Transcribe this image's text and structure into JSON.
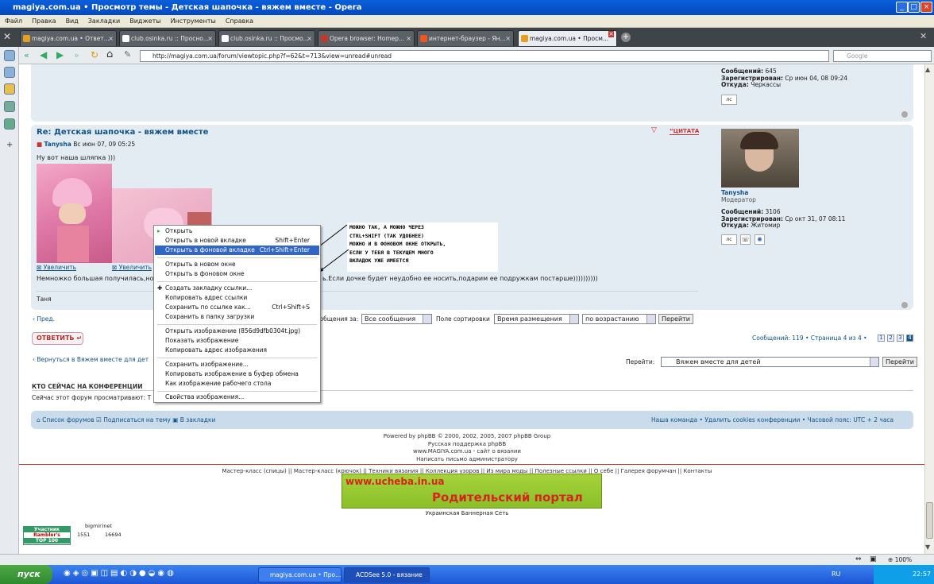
{
  "window": {
    "title": "magiya.com.ua • Просмотр темы - Детская шапочка - вяжем вместе - Opera"
  },
  "menu": [
    "Файл",
    "Правка",
    "Вид",
    "Закладки",
    "Виджеты",
    "Инструменты",
    "Справка"
  ],
  "tabs": [
    {
      "label": "magiya.com.ua • Ответ..."
    },
    {
      "label": "club.osinka.ru :: Просно..."
    },
    {
      "label": "club.osinka.ru :: Просмо..."
    },
    {
      "label": "Opera browser: Homep..."
    },
    {
      "label": "интернет-браузер - Ян..."
    },
    {
      "label": "magiya.com.ua • Просм..."
    }
  ],
  "address": {
    "url": "http://magiya.com.ua/forum/viewtopic.php?f=62&t=713&view=unread#unread",
    "search_placeholder": "Google"
  },
  "prev_user": {
    "posts_label": "Сообщений:",
    "posts": "645",
    "reg_label": "Зарегистрирован:",
    "reg": "Ср июн 04, 08 09:24",
    "from_label": "Откуда:",
    "from": "Черкассы",
    "pm": "лс"
  },
  "post": {
    "title": "Re: Детская шапочка - вяжем вместе",
    "author": "Tanysha",
    "date": "Вс июн 07, 09 05:25",
    "quote_label": "ЦИТАТА",
    "text1": "Ну вот наша шляпка )))",
    "zoom1": "Увеличить",
    "zoom2": "Увеличить",
    "text2_left": "Немножко большая получилась,но",
    "text2_right": "ь.Если дочке будет неудобно ее носить,подарим ее подружкам постарше))))))))))",
    "signature": "Таня",
    "user": {
      "name": "Tanysha",
      "rank": "Модератор",
      "posts_label": "Сообщений:",
      "posts": "3106",
      "reg_label": "Зарегистрирован:",
      "reg": "Ср окт 31, 07 08:11",
      "from_label": "Откуда:",
      "from": "Житомир",
      "pm": "лс"
    }
  },
  "sortbar": {
    "prev": "Пред.",
    "show_label": "ообщения за:",
    "show_value": "Все сообщения",
    "sort_label": "Поле сортировки",
    "sort_value": "Время размещения",
    "order_value": "по возрастанию",
    "go": "Перейти"
  },
  "reply": {
    "label": "ОТВЕТИТЬ"
  },
  "pagination": {
    "summary": "Сообщений: 119 • Страница 4 из 4 •",
    "pages": [
      "1",
      "2",
      "3",
      "4"
    ]
  },
  "back_link": "Вернуться в Вяжем вместе для дет",
  "jump": {
    "label": "Перейти:",
    "value": "Вяжем вместе для детей",
    "go": "Перейти"
  },
  "who": {
    "title": "КТО СЕЙЧАС НА КОНФЕРЕНЦИИ",
    "text": "Сейчас этот форум просматривают: Т"
  },
  "footer_nav": {
    "index": "Список форумов",
    "subscribe": "Подписаться на тему",
    "bookmark": "В закладки",
    "team": "Наша команда",
    "delete_cookies": "Удалить cookies конференции",
    "tz": "Часовой пояс: UTC + 2 часа"
  },
  "credits": [
    "Powered by phpBB © 2000, 2002, 2005, 2007 phpBB Group",
    "Русская поддержка phpBB",
    "www.MAGIYA.com.ua - сайт о вязании",
    "Написать письмо администратору"
  ],
  "bottom_links": "Мастер-класс (спицы) || Мастер-класс (крючок) || Техники вязания || Коллекция узоров || Из мира моды || Полезные ссылки || О себе || Галерея форумчан || Контакты",
  "banner": {
    "line1": "www.ucheba.in.ua",
    "line2": "Родительский портал",
    "network": "Украинская Баннерная Сеть"
  },
  "counters": {
    "rambler": [
      "Участник",
      "Rambler's",
      "TOP 100"
    ],
    "bigmir": "bigmir)net",
    "n1": "1551",
    "n2": "16694"
  },
  "context_menu": {
    "items": [
      {
        "label": "Открыть",
        "shortcut": ""
      },
      {
        "label": "Открыть в новой вкладке",
        "shortcut": "Shift+Enter"
      },
      {
        "label": "Открыть в фоновой вкладке",
        "shortcut": "Ctrl+Shift+Enter"
      },
      {
        "label": "Открыть в новом окне",
        "shortcut": ""
      },
      {
        "label": "Открыть в фоновом окне",
        "shortcut": ""
      },
      {
        "label": "Создать закладку ссылки...",
        "shortcut": ""
      },
      {
        "label": "Копировать адрес ссылки",
        "shortcut": ""
      },
      {
        "label": "Сохранить по ссылке как...",
        "shortcut": "Ctrl+Shift+S"
      },
      {
        "label": "Сохранить в папку загрузки",
        "shortcut": ""
      },
      {
        "label": "Открыть изображение (856d9dfb0304t.jpg)",
        "shortcut": ""
      },
      {
        "label": "Показать изображение",
        "shortcut": ""
      },
      {
        "label": "Копировать адрес изображения",
        "shortcut": ""
      },
      {
        "label": "Сохранить изображение...",
        "shortcut": ""
      },
      {
        "label": "Копировать изображение в буфер обмена",
        "shortcut": ""
      },
      {
        "label": "Как изображение рабочего стола",
        "shortcut": ""
      },
      {
        "label": "Свойства изображения...",
        "shortcut": ""
      }
    ]
  },
  "note": [
    "МОЖНО ТАК, А МОЖНО ЧЕРЕЗ",
    "CTRL+SHIFT (ТАК УДОБНЕЕ)",
    "МОЖНО И В ФОНОВОМ ОКНЕ ОТКРЫТЬ,",
    "ЕСЛИ У ТЕБЯ В ТЕКУЩЕМ МНОГО",
    "ВКЛАДОК УЖЕ ИМЕЕТСЯ"
  ],
  "status": {
    "zoom": "100%"
  },
  "taskbar": {
    "start": "пуск",
    "items": [
      "magiya.com.ua • Про...",
      "ACDSee 5.0 - вязание"
    ],
    "lang": "RU",
    "clock": "22:57"
  }
}
